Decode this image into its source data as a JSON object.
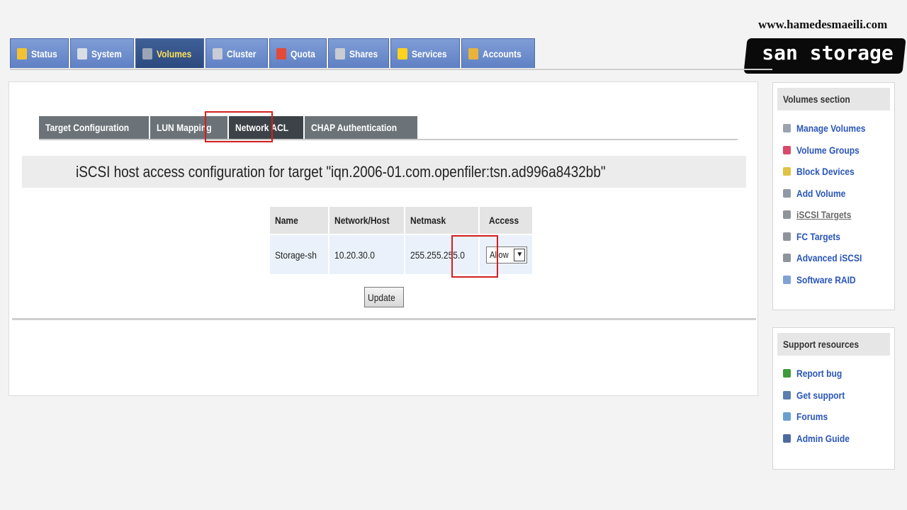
{
  "watermark": {
    "site": "www.hamedesmaeili.com",
    "brand": "san storage"
  },
  "topnav": [
    {
      "label": "Status",
      "icon": "status-icon",
      "color": "#f2c232"
    },
    {
      "label": "System",
      "icon": "system-icon",
      "color": "#d9dde6"
    },
    {
      "label": "Volumes",
      "icon": "volumes-icon",
      "color": "#9aa6b6",
      "active": true
    },
    {
      "label": "Cluster",
      "icon": "cluster-icon",
      "color": "#c7ccd6"
    },
    {
      "label": "Quota",
      "icon": "quota-icon",
      "color": "#e24a3a"
    },
    {
      "label": "Shares",
      "icon": "shares-icon",
      "color": "#c9ccd2"
    },
    {
      "label": "Services",
      "icon": "services-icon",
      "color": "#ffd21f"
    },
    {
      "label": "Accounts",
      "icon": "accounts-icon",
      "color": "#e8b33b"
    }
  ],
  "subtabs": [
    "Target Configuration",
    "LUN Mapping",
    "Network ACL",
    "CHAP Authentication"
  ],
  "active_subtab": "Network ACL",
  "heading": "iSCSI host access configuration for target \"iqn.2006-01.com.openfiler:tsn.ad996a8432bb\"",
  "acl_table": {
    "headers": {
      "name": "Name",
      "network": "Network/Host",
      "netmask": "Netmask",
      "access": "Access"
    },
    "rows": [
      {
        "name": "Storage-sh",
        "network": "10.20.30.0",
        "netmask": "255.255.255.0",
        "access": "Allow"
      }
    ]
  },
  "update_button": "Update",
  "highlight_color": "#d21f1f",
  "sidebar": {
    "volumes_section": {
      "title": "Volumes section",
      "items": [
        {
          "label": "Manage Volumes",
          "icon": "manage-volumes-icon",
          "color": "#9aa3b0"
        },
        {
          "label": "Volume Groups",
          "icon": "volume-groups-icon",
          "color": "#d64b6a"
        },
        {
          "label": "Block Devices",
          "icon": "block-devices-icon",
          "color": "#e0c246"
        },
        {
          "label": "Add Volume",
          "icon": "add-volume-icon",
          "color": "#8f9aa6"
        },
        {
          "label": "iSCSI Targets",
          "icon": "iscsi-targets-icon",
          "color": "#8f949c",
          "current": true
        },
        {
          "label": "FC Targets",
          "icon": "fc-targets-icon",
          "color": "#8f949c"
        },
        {
          "label": "Advanced iSCSI",
          "icon": "advanced-iscsi-icon",
          "color": "#8f949c"
        },
        {
          "label": "Software RAID",
          "icon": "software-raid-icon",
          "color": "#7fa2d6"
        }
      ]
    },
    "support_resources": {
      "title": "Support resources",
      "items": [
        {
          "label": "Report bug",
          "icon": "bug-icon",
          "color": "#3f9a3a"
        },
        {
          "label": "Get support",
          "icon": "support-icon",
          "color": "#5a7fb0"
        },
        {
          "label": "Forums",
          "icon": "forums-icon",
          "color": "#6aa0d0"
        },
        {
          "label": "Admin Guide",
          "icon": "guide-icon",
          "color": "#4d6aa0"
        }
      ]
    }
  }
}
